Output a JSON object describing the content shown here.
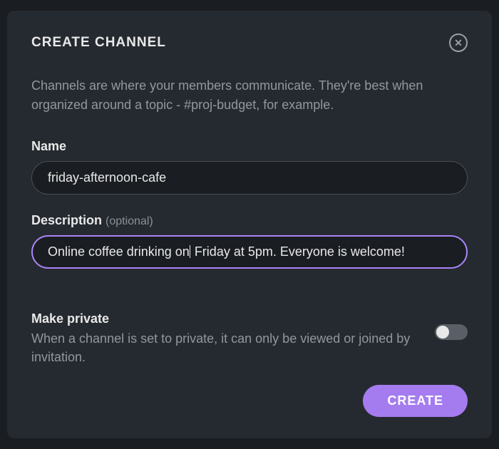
{
  "modal": {
    "title": "CREATE CHANNEL",
    "intro": "Channels are where your members communicate. They're best when organized around a topic - #proj-budget, for example.",
    "name": {
      "label": "Name",
      "value": "friday-afternoon-cafe"
    },
    "description": {
      "label": "Description ",
      "optional": "(optional)",
      "value_before": "Online coffee drinking on",
      "value_after": " Friday at 5pm. Everyone is welcome!"
    },
    "private": {
      "title": "Make private",
      "description": "When a channel is set to private, it can only be viewed or joined by invitation.",
      "enabled": false
    },
    "create_label": "CREATE"
  }
}
